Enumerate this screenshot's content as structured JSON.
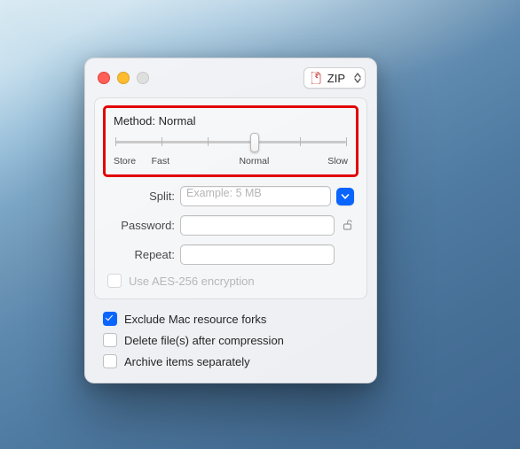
{
  "format": {
    "label": "ZIP"
  },
  "method": {
    "label_prefix": "Method: ",
    "current": "Normal",
    "stops": [
      "Store",
      "Fast",
      "Normal",
      "Slow"
    ]
  },
  "fields": {
    "split": {
      "label": "Split:",
      "placeholder": "Example: 5 MB",
      "value": ""
    },
    "password": {
      "label": "Password:",
      "value": ""
    },
    "repeat": {
      "label": "Repeat:",
      "value": ""
    }
  },
  "encryption": {
    "label": "Use AES-256 encryption",
    "checked": false,
    "enabled": false
  },
  "options": {
    "exclude_resource_forks": {
      "label": "Exclude Mac resource forks",
      "checked": true
    },
    "delete_after": {
      "label": "Delete file(s) after compression",
      "checked": false
    },
    "archive_separately": {
      "label": "Archive items separately",
      "checked": false
    }
  },
  "icons": {
    "zip": "zip-doc-icon",
    "lock": "unlock-icon",
    "dropdown": "chevron-down-icon"
  }
}
